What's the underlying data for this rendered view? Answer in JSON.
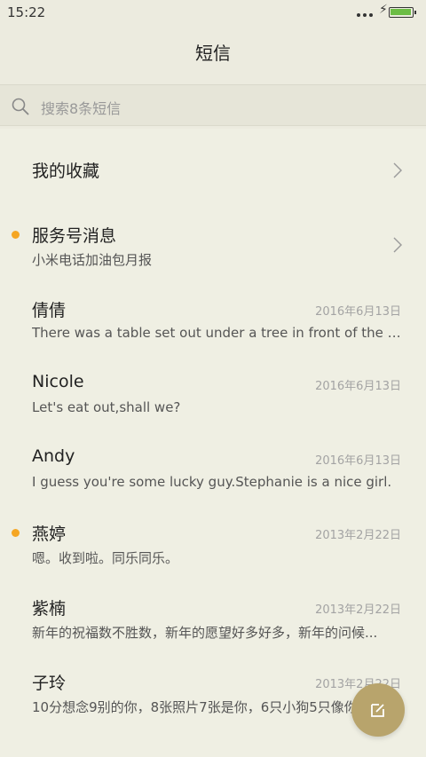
{
  "status_bar": {
    "time": "15:22"
  },
  "header": {
    "title": "短信"
  },
  "search": {
    "placeholder": "搜索8条短信"
  },
  "items": [
    {
      "title": "我的收藏"
    },
    {
      "title": "服务号消息",
      "subtitle": "小米电话加油包月报"
    },
    {
      "title": "倩倩",
      "date": "2016年6月13日",
      "preview": "There was a table set out under a tree in front of the ho..."
    },
    {
      "title": "Nicole",
      "date": "2016年6月13日",
      "preview": "Let's eat out,shall we?"
    },
    {
      "title": "Andy",
      "date": "2016年6月13日",
      "preview": "I guess you're some lucky guy.Stephanie is a nice girl."
    },
    {
      "title": "燕婷",
      "date": "2013年2月22日",
      "preview": "嗯。收到啦。同乐同乐。"
    },
    {
      "title": "紫楠",
      "date": "2013年2月22日",
      "preview": "新年的祝福数不胜数，新年的愿望好多好多，新年的问候..."
    },
    {
      "title": "子玲",
      "date": "2013年2月22日",
      "preview": "10分想念9别的你，8张照片7张是你，6只小狗5只像你"
    }
  ],
  "colors": {
    "unread_dot": "#f5a623",
    "fab": "#b8a46c",
    "background": "#efefe3"
  },
  "icons": {
    "search": "search-icon",
    "chevron": "chevron-right-icon",
    "compose": "compose-icon"
  }
}
